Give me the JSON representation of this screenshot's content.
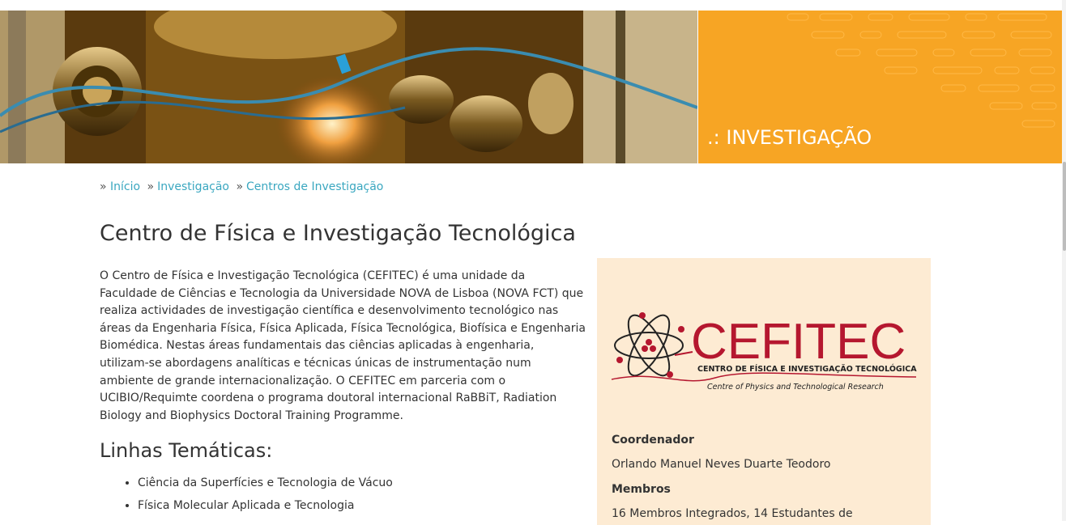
{
  "banner": {
    "title": "INVESTIGAÇÃO",
    "title_prefix": ".:",
    "accent_color": "#f7a524"
  },
  "breadcrumb": {
    "separator": "»",
    "items": [
      {
        "label": "Início"
      },
      {
        "label": "Investigação"
      },
      {
        "label": "Centros de Investigação"
      }
    ]
  },
  "page": {
    "title": "Centro de Física e Investigação Tecnológica",
    "intro": "O Centro de Física e Investigação Tecnológica (CEFITEC) é uma unidade da Faculdade de Ciências e Tecnologia da Universidade NOVA de Lisboa (NOVA FCT) que realiza actividades de investigação científica e desenvolvimento tecnológico nas áreas da Engenharia Física, Física Aplicada, Física Tecnológica, Biofísica e Engenharia Biomédica. Nestas áreas fundamentais das ciências aplicadas à engenharia, utilizam-se abordagens analíticas e técnicas únicas de instrumentação num ambiente de grande internacionalização. O CEFITEC em parceria com o UCIBIO/Requimte coordena o programa doutoral internacional RaBBiT, Radiation Biology and Biophysics Doctoral Training Programme.",
    "themes_title": "Linhas Temáticas:",
    "themes": [
      "Ciência da Superfícies e Tecnologia de Vácuo",
      "Física Molecular Aplicada e Tecnologia"
    ]
  },
  "sidebar": {
    "logo": {
      "name": "CEFITEC",
      "subtitle": "CENTRO DE FÍSICA E INVESTIGAÇÃO TECNOLÓGICA",
      "tagline": "Centre of Physics and Technological Research",
      "brand_color": "#b5172f"
    },
    "coordinator_label": "Coordenador",
    "coordinator": "Orlando Manuel Neves Duarte Teodoro",
    "members_label": "Membros",
    "members": "16 Membros Integrados, 14 Estudantes de"
  },
  "colors": {
    "link": "#3aa7c0",
    "sidebar_bg": "#fdebd3",
    "text": "#333333"
  }
}
